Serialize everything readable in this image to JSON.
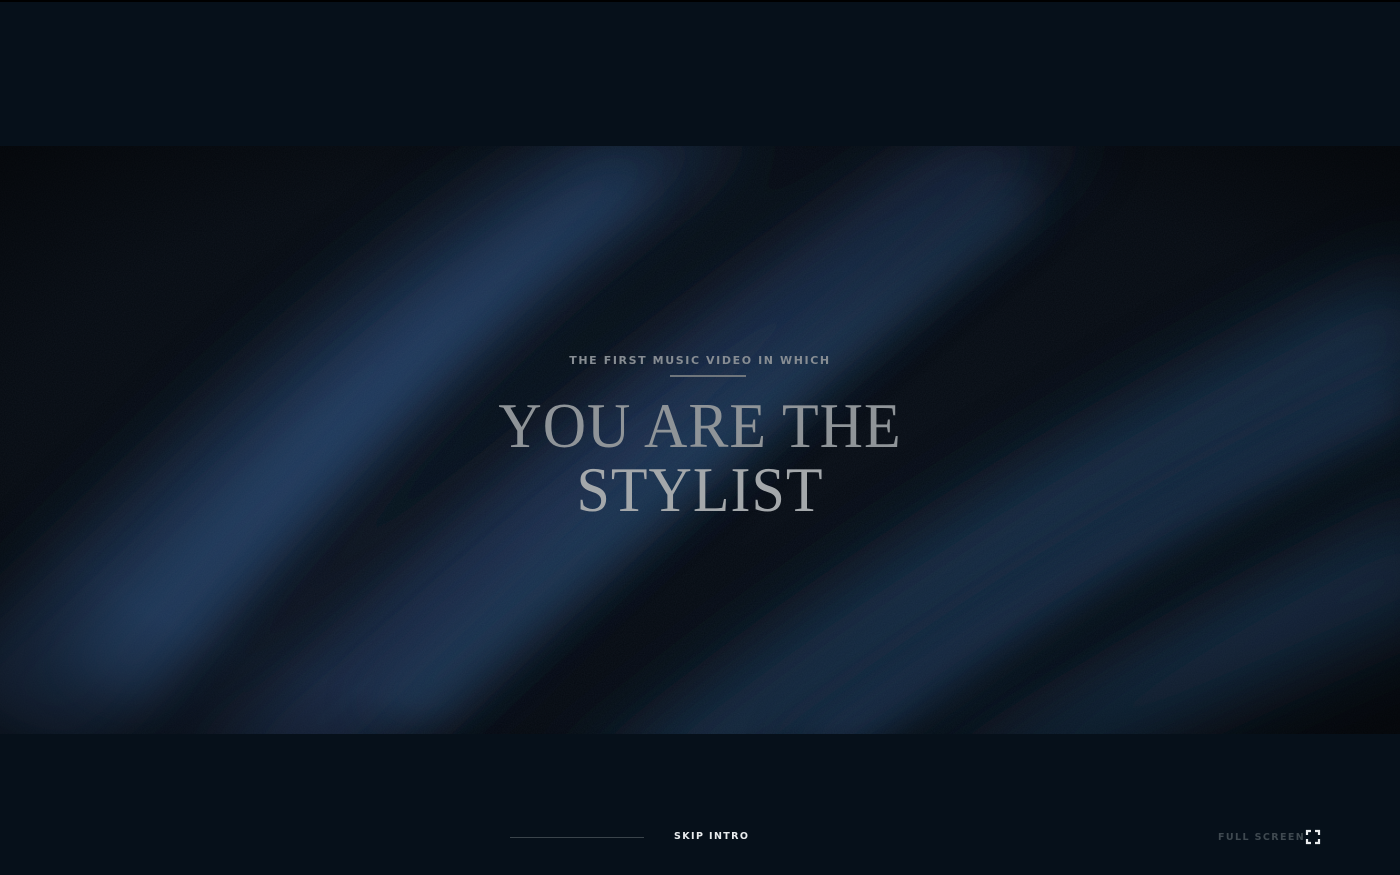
{
  "intro": {
    "eyebrow": "THE FIRST MUSIC VIDEO IN WHICH",
    "headline_line1": "YOU ARE THE",
    "headline_line2": "STYLIST"
  },
  "controls": {
    "skip_label": "SKIP INTRO",
    "fullscreen_label": "FULL SCREEN",
    "fullscreen_icon": "fullscreen-icon"
  },
  "colors": {
    "background": "#06101a",
    "video_dark": "#050b13",
    "fabric_highlight": "#1e3a5f",
    "headline": "#a4a8ab",
    "skip_text": "#e9ecee",
    "fullscreen_text": "#3f4950"
  }
}
